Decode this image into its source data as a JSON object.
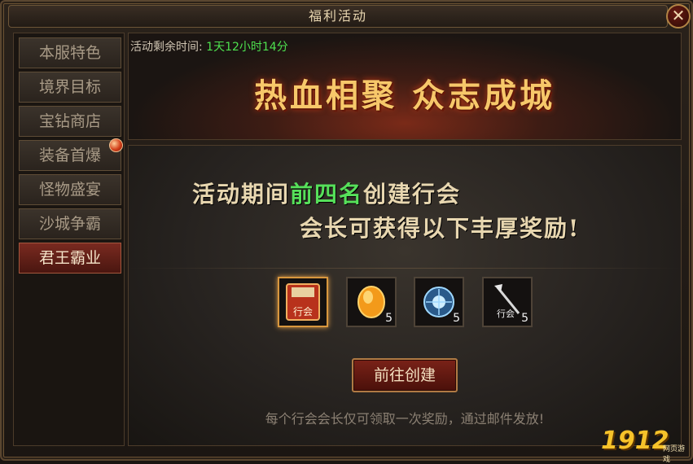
{
  "window": {
    "title": "福利活动",
    "close_label": "✕"
  },
  "sidebar": {
    "items": [
      {
        "label": "本服特色",
        "active": false,
        "badge": false
      },
      {
        "label": "境界目标",
        "active": false,
        "badge": false
      },
      {
        "label": "宝钻商店",
        "active": false,
        "badge": false
      },
      {
        "label": "装备首爆",
        "active": false,
        "badge": true
      },
      {
        "label": "怪物盛宴",
        "active": false,
        "badge": false
      },
      {
        "label": "沙城争霸",
        "active": false,
        "badge": false
      },
      {
        "label": "君王霸业",
        "active": true,
        "badge": false
      }
    ]
  },
  "banner": {
    "timer_label": "活动剩余时间: ",
    "timer_value": "1天12小时14分",
    "title": "热血相聚 众志成城"
  },
  "content": {
    "line1_pre": "活动期间",
    "line1_highlight": "前四名",
    "line1_post": "创建行会",
    "line2": "会长可获得以下丰厚奖励!",
    "rewards": [
      {
        "icon": "guild-charter-icon",
        "label": "行会",
        "count": ""
      },
      {
        "icon": "golden-gem-icon",
        "label": "",
        "count": "5"
      },
      {
        "icon": "blue-orb-icon",
        "label": "",
        "count": "5"
      },
      {
        "icon": "guild-token-icon",
        "label": "行会",
        "count": "5"
      }
    ],
    "button_label": "前往创建",
    "note": "每个行会会长仅可领取一次奖励，通过邮件发放!"
  },
  "watermark": {
    "number": "1912",
    "tag": "网页游戏"
  },
  "colors": {
    "accent_green": "#4ee04e",
    "gold": "#f7c86a",
    "active_tab": "#7a2a20"
  }
}
